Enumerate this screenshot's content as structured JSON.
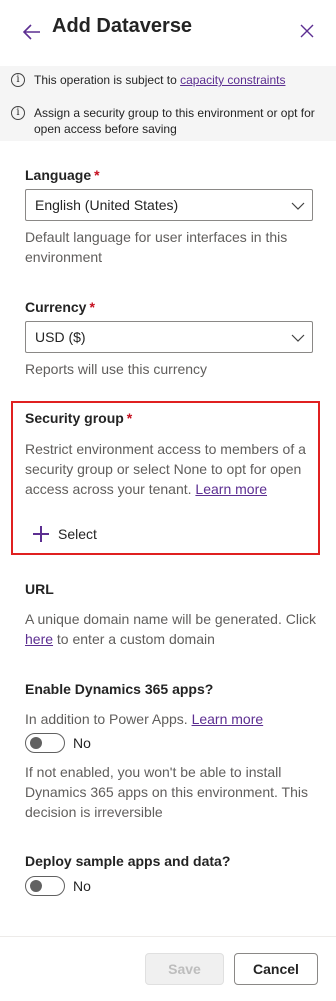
{
  "header": {
    "title": "Add Dataverse"
  },
  "info": {
    "row1_text": "This operation is subject to ",
    "row1_link": "capacity constraints",
    "row2_text": "Assign a security group to this environment or opt for open access before saving"
  },
  "language": {
    "label": "Language",
    "required": "*",
    "value": "English (United States)",
    "description": "Default language for user interfaces in this environment"
  },
  "currency": {
    "label": "Currency",
    "required": "*",
    "value": "USD ($)",
    "description": "Reports will use this currency"
  },
  "security_group": {
    "label": "Security group",
    "required": "*",
    "description": "Restrict environment access to members of a security group or select None to opt for open access across your tenant.",
    "learn_more": "Learn more",
    "select_label": "Select"
  },
  "url": {
    "label": "URL",
    "desc_prefix": "A unique domain name will be generated. Click ",
    "desc_link": "here",
    "desc_suffix": " to enter a custom domain"
  },
  "dynamics": {
    "label": "Enable Dynamics 365 apps?",
    "desc_prefix": "In addition to Power Apps. ",
    "learn_more": "Learn more",
    "toggle_state": "No",
    "note": "If not enabled, you won't be able to install Dynamics 365 apps on this environment. This decision is irreversible"
  },
  "sample": {
    "label": "Deploy sample apps and data?",
    "toggle_state": "No"
  },
  "footer": {
    "save_label": "Save",
    "cancel_label": "Cancel"
  },
  "colors": {
    "accent": "#5c2e91",
    "required": "#c50f1f",
    "highlight_border": "#e02020"
  },
  "icons": {
    "back": "arrow-left-icon",
    "close": "close-icon",
    "info": "info-icon",
    "chevron": "chevron-down-icon",
    "add": "plus-icon"
  }
}
